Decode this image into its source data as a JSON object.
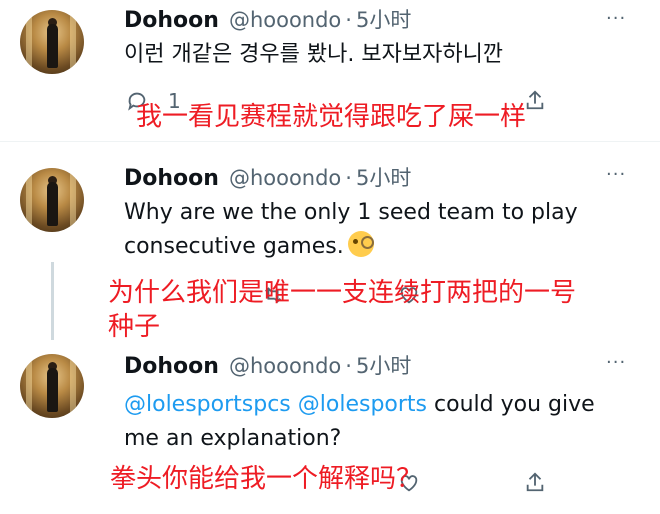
{
  "tweets": [
    {
      "author": "Dohoon",
      "handle": "@hooondo",
      "separator": "·",
      "time": "5小时",
      "more": "···",
      "text": "이런 개같은 경우를 봤나. 보자보자하니깐",
      "reply_count": "1",
      "translation": "我一看见赛程就觉得跟吃了屎一样"
    },
    {
      "author": "Dohoon",
      "handle": "@hooondo",
      "separator": "·",
      "time": "5小时",
      "more": "···",
      "text_line1": "Why are we the only 1 seed team to play",
      "text_line2": "consecutive games.",
      "emoji": "face-with-monocle",
      "translation_line1": "为什么我们是唯一一支连续打两把的一号",
      "translation_line2": "种子"
    },
    {
      "author": "Dohoon",
      "handle": "@hooondo",
      "separator": "·",
      "time": "5小时",
      "more": "···",
      "mention1": "@lolesportspcs",
      "mention2": "@lolesports",
      "text_line1_rest": "could you give",
      "text_line2": "me an explanation?",
      "translation": "拳头你能给我一个解释吗？"
    }
  ]
}
